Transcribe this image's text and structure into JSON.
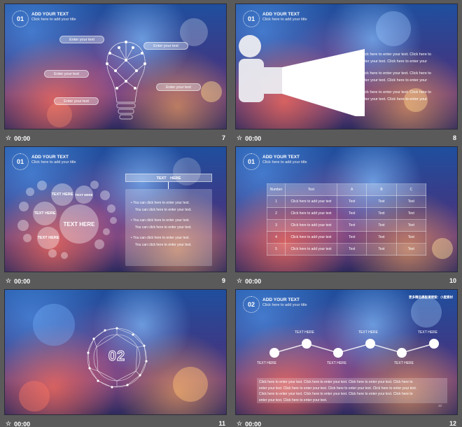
{
  "common": {
    "timer": "00:00",
    "header_title": "ADD YOUR TEXT",
    "header_sub": "Click here to add your title"
  },
  "slides": [
    {
      "number": "7",
      "badge": "01",
      "pills": [
        "Enter your text",
        "Enter your text",
        "Enter your text",
        "Enter your text",
        "Enter your text"
      ]
    },
    {
      "number": "8",
      "badge": "01",
      "lines": [
        "Click here to enter your text. Click here to",
        "enter your text. Click here to enter your",
        "Click here to enter your text. Click here to",
        "enter your text. Click here to enter your",
        "Click here to enter your text. Click here to",
        "enter your text. Click here to enter your"
      ]
    },
    {
      "number": "9",
      "badge": "01",
      "box_title": "TEXT　HERE",
      "circles": [
        "TEXT HERE",
        "TEXT HERE",
        "TEXT HERE",
        "TEXT HERE",
        "TEXT HERE"
      ],
      "bullets": [
        "You can click here to enter your text.",
        "You can click here to enter your text.",
        "You can click here to enter your text.",
        "You can click here to enter your text.",
        "You can click here to enter your text.",
        "You can click here to enter your text."
      ]
    },
    {
      "number": "10",
      "badge": "01",
      "table": {
        "headers": [
          "Number",
          "Text",
          "A",
          "B",
          "C"
        ],
        "rows": [
          [
            "1",
            "Click here to add your text",
            "Text",
            "Text",
            "Text"
          ],
          [
            "2",
            "Click here to add your text",
            "Text",
            "Text",
            "Text"
          ],
          [
            "3",
            "Click here to add your text",
            "Text",
            "Text",
            "Text"
          ],
          [
            "4",
            "Click here to add your text",
            "Text",
            "Text",
            "Text"
          ],
          [
            "5",
            "Click here to add your text",
            "Text",
            "Text",
            "Text"
          ]
        ]
      }
    },
    {
      "number": "11",
      "badge": "02"
    },
    {
      "number": "12",
      "badge": "02",
      "corner_note": "更多精品模板请搜索：小屋素材",
      "top_labels": [
        "TEXT HERE",
        "TEXT HERE",
        "TEXT HERE"
      ],
      "bottom_labels": [
        "TEXT HERE",
        "TEXT HERE",
        "TEXT HERE"
      ],
      "paragraph": [
        "Click here to enter your text. Click here to enter your text. Click here to enter your text. Click here to",
        "enter your text. Click here to enter your text. Click here to enter your text. Click here to enter your text.",
        "Click here to enter your text. Click here to enter your text. Click here to enter your text. Click here to",
        "enter your text. Click here to enter your text."
      ],
      "page_mark": "12"
    }
  ],
  "colors": {
    "background": "#5a5a5a",
    "accent": "#ffffff"
  }
}
